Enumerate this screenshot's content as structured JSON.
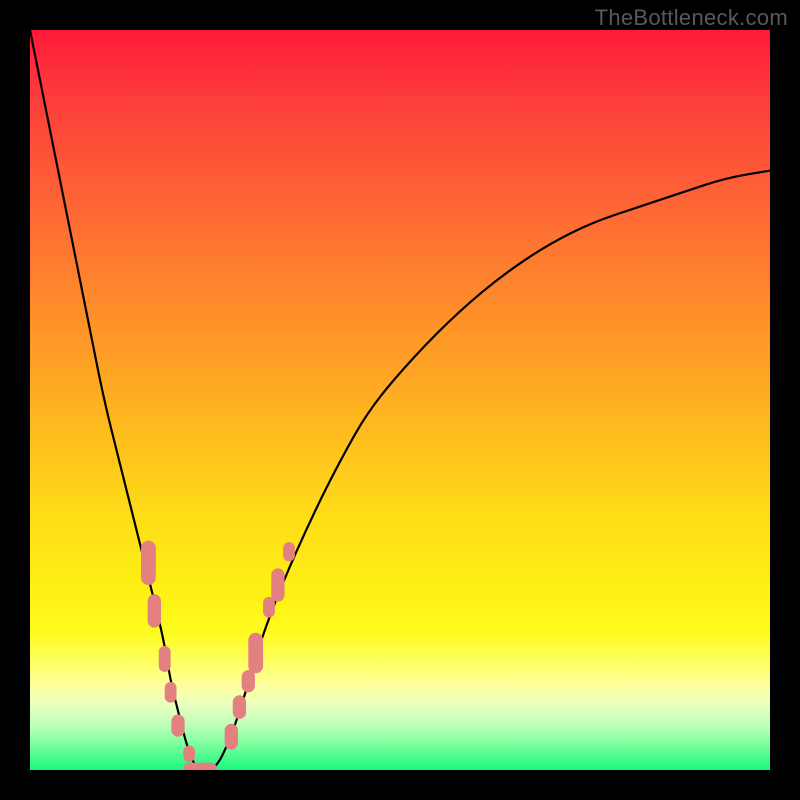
{
  "watermark": "TheBottleneck.com",
  "chart_data": {
    "type": "line",
    "title": "",
    "xlabel": "",
    "ylabel": "",
    "xlim": [
      0,
      100
    ],
    "ylim": [
      0,
      100
    ],
    "grid": false,
    "legend": false,
    "series": [
      {
        "name": "bottleneck-curve",
        "color": "#000000",
        "x": [
          0,
          2,
          4,
          6,
          8,
          10,
          12,
          14,
          16,
          18,
          19,
          20,
          21,
          22,
          23,
          25,
          27,
          29,
          31,
          34,
          38,
          42,
          46,
          52,
          58,
          64,
          70,
          76,
          82,
          88,
          94,
          100
        ],
        "y": [
          100,
          90,
          80,
          70,
          60,
          50,
          42,
          34,
          26,
          18,
          12,
          8,
          4,
          1,
          0,
          0,
          4,
          10,
          17,
          25,
          34,
          42,
          49,
          56,
          62,
          67,
          71,
          74,
          76,
          78,
          80,
          81
        ]
      }
    ],
    "markers": [
      {
        "name": "left-branch-dots",
        "color": "#e38080",
        "shape": "rounded-rect",
        "points": [
          {
            "x": 16.0,
            "y": 28.0,
            "w": 2.0,
            "h": 6.0
          },
          {
            "x": 16.8,
            "y": 21.5,
            "w": 1.8,
            "h": 4.5
          },
          {
            "x": 18.2,
            "y": 15.0,
            "w": 1.6,
            "h": 3.5
          },
          {
            "x": 19.0,
            "y": 10.5,
            "w": 1.6,
            "h": 2.8
          },
          {
            "x": 20.0,
            "y": 6.0,
            "w": 1.8,
            "h": 3.0
          },
          {
            "x": 21.5,
            "y": 2.2,
            "w": 1.6,
            "h": 2.2
          }
        ]
      },
      {
        "name": "trough-dots",
        "color": "#e38080",
        "shape": "rounded-rect",
        "points": [
          {
            "x": 23.0,
            "y": 0.2,
            "w": 4.5,
            "h": 1.6
          }
        ]
      },
      {
        "name": "right-branch-dots",
        "color": "#e38080",
        "shape": "rounded-rect",
        "points": [
          {
            "x": 27.2,
            "y": 4.5,
            "w": 1.8,
            "h": 3.5
          },
          {
            "x": 28.3,
            "y": 8.5,
            "w": 1.8,
            "h": 3.2
          },
          {
            "x": 29.5,
            "y": 12.0,
            "w": 1.8,
            "h": 3.0
          },
          {
            "x": 30.5,
            "y": 15.8,
            "w": 2.0,
            "h": 5.5
          },
          {
            "x": 32.3,
            "y": 22.0,
            "w": 1.6,
            "h": 2.8
          },
          {
            "x": 33.5,
            "y": 25.0,
            "w": 1.8,
            "h": 4.5
          },
          {
            "x": 35.0,
            "y": 29.5,
            "w": 1.6,
            "h": 2.6
          }
        ]
      }
    ],
    "background_gradient": {
      "top_color": "#fe1a3a",
      "mid_color": "#fef314",
      "bottom_color": "#17f97e"
    }
  }
}
